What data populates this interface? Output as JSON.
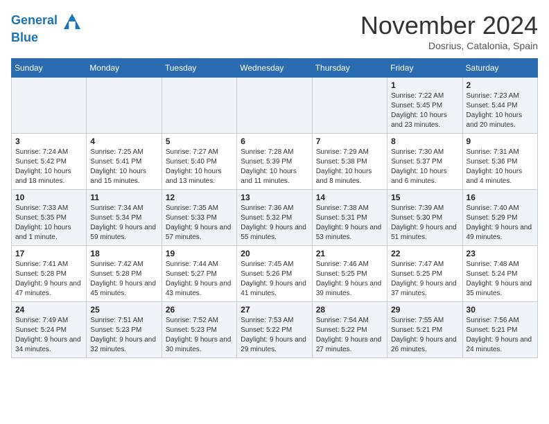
{
  "header": {
    "logo_line1": "General",
    "logo_line2": "Blue",
    "month": "November 2024",
    "location": "Dosrius, Catalonia, Spain"
  },
  "weekdays": [
    "Sunday",
    "Monday",
    "Tuesday",
    "Wednesday",
    "Thursday",
    "Friday",
    "Saturday"
  ],
  "weeks": [
    [
      {
        "day": "",
        "info": ""
      },
      {
        "day": "",
        "info": ""
      },
      {
        "day": "",
        "info": ""
      },
      {
        "day": "",
        "info": ""
      },
      {
        "day": "",
        "info": ""
      },
      {
        "day": "1",
        "info": "Sunrise: 7:22 AM\nSunset: 5:45 PM\nDaylight: 10 hours and 23 minutes."
      },
      {
        "day": "2",
        "info": "Sunrise: 7:23 AM\nSunset: 5:44 PM\nDaylight: 10 hours and 20 minutes."
      }
    ],
    [
      {
        "day": "3",
        "info": "Sunrise: 7:24 AM\nSunset: 5:42 PM\nDaylight: 10 hours and 18 minutes."
      },
      {
        "day": "4",
        "info": "Sunrise: 7:25 AM\nSunset: 5:41 PM\nDaylight: 10 hours and 15 minutes."
      },
      {
        "day": "5",
        "info": "Sunrise: 7:27 AM\nSunset: 5:40 PM\nDaylight: 10 hours and 13 minutes."
      },
      {
        "day": "6",
        "info": "Sunrise: 7:28 AM\nSunset: 5:39 PM\nDaylight: 10 hours and 11 minutes."
      },
      {
        "day": "7",
        "info": "Sunrise: 7:29 AM\nSunset: 5:38 PM\nDaylight: 10 hours and 8 minutes."
      },
      {
        "day": "8",
        "info": "Sunrise: 7:30 AM\nSunset: 5:37 PM\nDaylight: 10 hours and 6 minutes."
      },
      {
        "day": "9",
        "info": "Sunrise: 7:31 AM\nSunset: 5:36 PM\nDaylight: 10 hours and 4 minutes."
      }
    ],
    [
      {
        "day": "10",
        "info": "Sunrise: 7:33 AM\nSunset: 5:35 PM\nDaylight: 10 hours and 1 minute."
      },
      {
        "day": "11",
        "info": "Sunrise: 7:34 AM\nSunset: 5:34 PM\nDaylight: 9 hours and 59 minutes."
      },
      {
        "day": "12",
        "info": "Sunrise: 7:35 AM\nSunset: 5:33 PM\nDaylight: 9 hours and 57 minutes."
      },
      {
        "day": "13",
        "info": "Sunrise: 7:36 AM\nSunset: 5:32 PM\nDaylight: 9 hours and 55 minutes."
      },
      {
        "day": "14",
        "info": "Sunrise: 7:38 AM\nSunset: 5:31 PM\nDaylight: 9 hours and 53 minutes."
      },
      {
        "day": "15",
        "info": "Sunrise: 7:39 AM\nSunset: 5:30 PM\nDaylight: 9 hours and 51 minutes."
      },
      {
        "day": "16",
        "info": "Sunrise: 7:40 AM\nSunset: 5:29 PM\nDaylight: 9 hours and 49 minutes."
      }
    ],
    [
      {
        "day": "17",
        "info": "Sunrise: 7:41 AM\nSunset: 5:28 PM\nDaylight: 9 hours and 47 minutes."
      },
      {
        "day": "18",
        "info": "Sunrise: 7:42 AM\nSunset: 5:28 PM\nDaylight: 9 hours and 45 minutes."
      },
      {
        "day": "19",
        "info": "Sunrise: 7:44 AM\nSunset: 5:27 PM\nDaylight: 9 hours and 43 minutes."
      },
      {
        "day": "20",
        "info": "Sunrise: 7:45 AM\nSunset: 5:26 PM\nDaylight: 9 hours and 41 minutes."
      },
      {
        "day": "21",
        "info": "Sunrise: 7:46 AM\nSunset: 5:25 PM\nDaylight: 9 hours and 39 minutes."
      },
      {
        "day": "22",
        "info": "Sunrise: 7:47 AM\nSunset: 5:25 PM\nDaylight: 9 hours and 37 minutes."
      },
      {
        "day": "23",
        "info": "Sunrise: 7:48 AM\nSunset: 5:24 PM\nDaylight: 9 hours and 35 minutes."
      }
    ],
    [
      {
        "day": "24",
        "info": "Sunrise: 7:49 AM\nSunset: 5:24 PM\nDaylight: 9 hours and 34 minutes."
      },
      {
        "day": "25",
        "info": "Sunrise: 7:51 AM\nSunset: 5:23 PM\nDaylight: 9 hours and 32 minutes."
      },
      {
        "day": "26",
        "info": "Sunrise: 7:52 AM\nSunset: 5:23 PM\nDaylight: 9 hours and 30 minutes."
      },
      {
        "day": "27",
        "info": "Sunrise: 7:53 AM\nSunset: 5:22 PM\nDaylight: 9 hours and 29 minutes."
      },
      {
        "day": "28",
        "info": "Sunrise: 7:54 AM\nSunset: 5:22 PM\nDaylight: 9 hours and 27 minutes."
      },
      {
        "day": "29",
        "info": "Sunrise: 7:55 AM\nSunset: 5:21 PM\nDaylight: 9 hours and 26 minutes."
      },
      {
        "day": "30",
        "info": "Sunrise: 7:56 AM\nSunset: 5:21 PM\nDaylight: 9 hours and 24 minutes."
      }
    ]
  ]
}
